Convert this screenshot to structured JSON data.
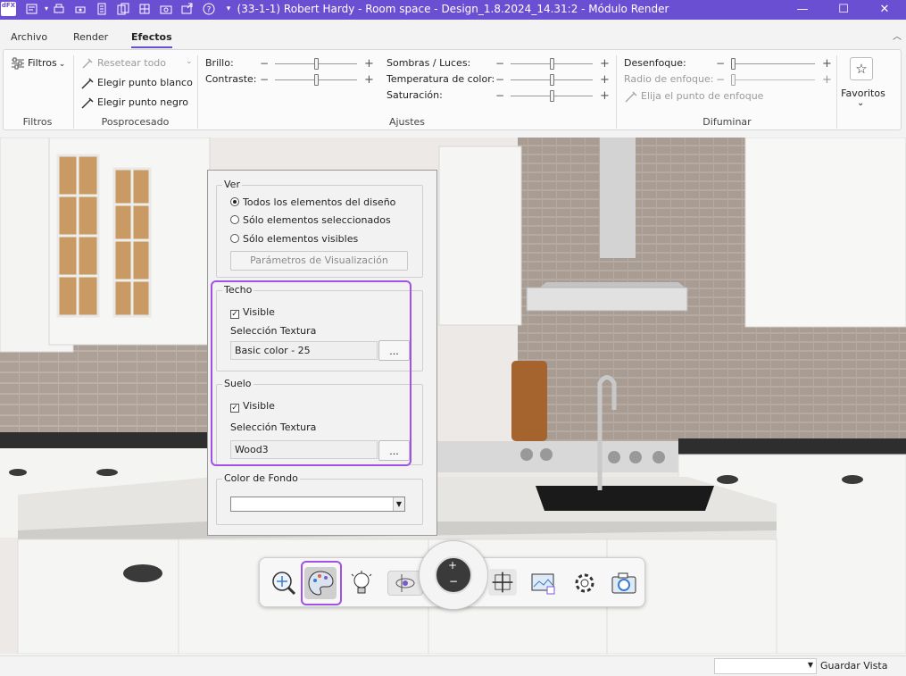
{
  "window": {
    "app_badge": "dFX",
    "title": "(33-1-1) Robert Hardy - Room space - Design_1.8.2024_14.31:2 - Módulo Render",
    "controls": [
      "minimize-icon",
      "maximize-icon",
      "close-icon"
    ]
  },
  "quick_access": [
    "new-design-icon",
    "print-icon",
    "print-preview-icon",
    "document-icon",
    "copy-icon",
    "grid-icon",
    "camera-icon",
    "export-icon",
    "settings-icon",
    "help-icon",
    "customize-icon"
  ],
  "tabs": [
    {
      "label": "Archivo",
      "active": false
    },
    {
      "label": "Render",
      "active": false
    },
    {
      "label": "Efectos",
      "active": true
    }
  ],
  "ribbon": {
    "filtros": {
      "button": "Filtros",
      "group": "Filtros"
    },
    "posprocesado": {
      "reset": "Resetear todo",
      "white_point": "Elegir punto blanco",
      "black_point": "Elegir punto negro",
      "group": "Posprocesado"
    },
    "ajustes": {
      "brillo": "Brillo:",
      "contraste": "Contraste:",
      "sombras": "Sombras / Luces:",
      "temperatura": "Temperatura de color:",
      "saturacion": "Saturación:",
      "group": "Ajustes"
    },
    "difuminar": {
      "desenfoque": "Desenfoque:",
      "radio": "Radio de enfoque:",
      "focus_point": "Elija el punto de enfoque",
      "group": "Difuminar"
    },
    "favoritos": {
      "label": "Favoritos"
    }
  },
  "sliders": {
    "brillo": 0.5,
    "contraste": 0.5,
    "sombras": 0.5,
    "temperatura": 0.5,
    "saturacion": 0.5,
    "desenfoque": 0.0,
    "radio": 0.0
  },
  "panel": {
    "ver": {
      "title": "Ver",
      "options": [
        "Todos los elementos del diseño",
        "Sólo elementos seleccionados",
        "Sólo elementos visibles"
      ],
      "selected": 0,
      "params_button": "Parámetros de Visualización"
    },
    "techo": {
      "title": "Techo",
      "visible_label": "Visible",
      "visible": true,
      "texture_label": "Selección Textura",
      "texture": "Basic color - 25",
      "browse": "..."
    },
    "suelo": {
      "title": "Suelo",
      "visible_label": "Visible",
      "visible": true,
      "texture_label": "Selección Textura",
      "texture": "Wood3",
      "browse": "..."
    },
    "fondo": {
      "title": "Color de Fondo",
      "color": "#ffffff"
    }
  },
  "navbar": [
    "zoom-pan-icon",
    "palette-icon",
    "lightbulb-icon",
    "orbit-icon",
    "zoom-in-icon",
    "zoom-out-icon",
    "fit-view-icon",
    "image-view-icon",
    "gear-icon",
    "camera-icon"
  ],
  "status": {
    "view_select": "",
    "save_view": "Guardar Vista"
  },
  "colors": {
    "accent": "#6b4fd2",
    "highlight": "#a052e6"
  }
}
